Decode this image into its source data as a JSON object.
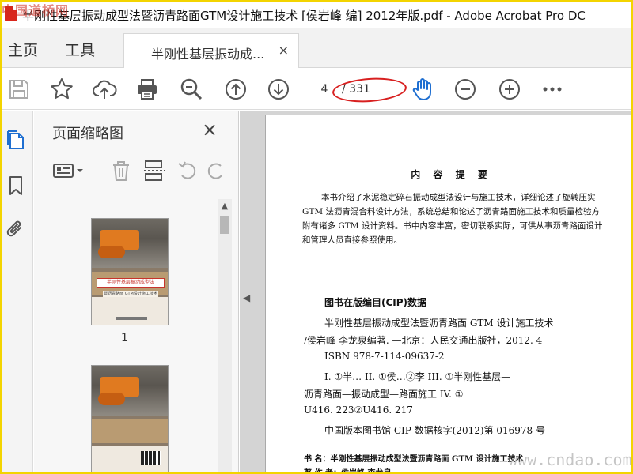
{
  "watermark_top": "中国道桥网",
  "watermark_bottom": "www.cndao.com",
  "window": {
    "title": "半刚性基层振动成型法暨沥青路面GTM设计施工技术 [侯岩峰 编] 2012年版.pdf - Adobe Acrobat Pro DC"
  },
  "menu": {
    "home": "主页",
    "tools": "工具"
  },
  "tab": {
    "label": "半刚性基层振动成...",
    "close": "×"
  },
  "toolbar": {
    "current_page": "4",
    "total_pages": "/ 331",
    "icons": [
      "save-icon",
      "star-icon",
      "upload-cloud-icon",
      "print-icon",
      "zoom-search-icon",
      "page-up-icon",
      "page-down-icon",
      "hand-icon",
      "zoom-out-icon",
      "zoom-in-icon",
      "more-icon"
    ]
  },
  "rail": {
    "icons": [
      "pages-icon",
      "bookmark-icon",
      "attachment-icon"
    ]
  },
  "panel": {
    "title": "页面缩略图",
    "close": "×",
    "thumbnails": [
      {
        "number": "1",
        "title_lines": [
          "半刚性基层振动成型法",
          "暨沥青路面",
          "GTM设计施工技术"
        ]
      }
    ]
  },
  "page": {
    "heading": "内 容 提 要",
    "summary": [
      "本书介绍了水泥稳定碎石振动成型法设计与施工技术，详细论述了旋转压实",
      "GTM 法沥青混合料设计方法，系统总结和论述了沥青路面施工技术和质量检验方",
      "附有诸多 GTM 设计资料。书中内容丰富，密切联系实际，可供从事沥青路面设计",
      "和管理人员直接参照使用。"
    ],
    "cip_heading": "图书在版编目(CIP)数据",
    "cip_lines": [
      "半刚性基层振动成型法暨沥青路面 GTM 设计施工技术",
      "/侯岩峰    李龙泉编著. —北京：人民交通出版社，2012. 4",
      "ISBN  978-7-114-09637-2",
      "I. ①半…   II. ①侯…②李   III. ①半刚性基层—",
      "沥青路面—振动成型—路面施工   IV. ①",
      "U416. 223②U416. 217",
      "中国版本图书馆 CIP 数据核字(2012)第 016978 号"
    ],
    "bottom_lines": [
      "书      名：半刚性基层振动成型法暨沥青路面 GTM 设计施工技术",
      "著  作  者：侯岩峰    李龙泉"
    ]
  },
  "colors": {
    "accent_red": "#d82020",
    "frame": "#f3d400",
    "hand_tool": "#1f6fd1"
  }
}
